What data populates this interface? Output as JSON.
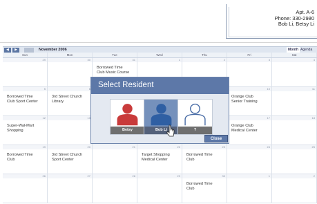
{
  "contact": {
    "apartment": "Apt. A-6",
    "phone": "Phone: 330-2980",
    "names": "Bob Li, Betsy Li"
  },
  "calendar": {
    "month": "November 2006",
    "views": [
      "Month",
      "Agenda"
    ],
    "weekdays": [
      "Sun",
      "Mon",
      "Tue",
      "Wed",
      "Thu",
      "Fri",
      "Sat"
    ],
    "weeks": [
      [
        "29",
        "30",
        "31",
        "1",
        "2",
        "3",
        "4"
      ],
      [
        "5",
        "6",
        "7",
        "8",
        "9",
        "10",
        "11"
      ],
      [
        "12",
        "13",
        "14",
        "15",
        "16",
        "17",
        "18"
      ],
      [
        "19",
        "20",
        "21",
        "22",
        "23",
        "24",
        "25"
      ],
      [
        "26",
        "27",
        "28",
        "29",
        "30",
        "1",
        "2"
      ]
    ],
    "events": {
      "w0d2": [
        "Borrowed Time",
        "Club Music Course"
      ],
      "w1d0": [
        "Borrowed Time",
        "Club Sport Center"
      ],
      "w1d1": [
        "3rd Street Church",
        "Library"
      ],
      "w1d5": [
        "Orange Club",
        "Senior Training"
      ],
      "w2d0": [
        "Super-Wal-Mart",
        "Shopping"
      ],
      "w2d5": [
        "Orange Club",
        "Medical Center"
      ],
      "w3d0": [
        "Borrowed Time",
        "Club"
      ],
      "w3d1": [
        "3rd Street Church",
        "Sport Center"
      ],
      "w3d3": [
        "Target Shopping",
        "Medical Center"
      ],
      "w3d4": [
        "Borrowed Time",
        "Club"
      ],
      "w4d4": [
        "Borrowed Time",
        "Club"
      ]
    }
  },
  "modal": {
    "title": "Select Resident",
    "residents": [
      {
        "label": "Betsy",
        "color": "#c93b3b",
        "style": "filled"
      },
      {
        "label": "Bob Li",
        "color": "#3a6cb0",
        "style": "filled"
      },
      {
        "label": "?",
        "color": "#4a6da6",
        "style": "outline"
      }
    ],
    "close_label": "Close"
  },
  "colors": {
    "accent": "#5d78a8",
    "betsy": "#c93b3b",
    "bob": "#3a6cb0"
  }
}
